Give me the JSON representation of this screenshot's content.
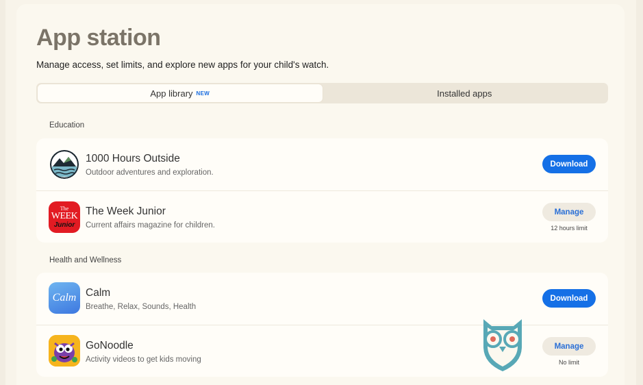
{
  "header": {
    "title": "App station",
    "subtitle": "Manage access, set limits, and explore new apps for your child's watch."
  },
  "tabs": [
    {
      "label": "App library",
      "badge": "NEW",
      "active": true
    },
    {
      "label": "Installed apps",
      "active": false
    }
  ],
  "sections": [
    {
      "label": "Education",
      "apps": [
        {
          "name": "1000 Hours Outside",
          "description": "Outdoor adventures and exploration.",
          "action": "Download",
          "icon": "mountain-lake-icon"
        },
        {
          "name": "The Week Junior",
          "description": "Current affairs magazine for children.",
          "action": "Manage",
          "limit": "12 hours limit",
          "icon": "week-junior-logo",
          "icon_text_top": "The",
          "icon_text_mid": "WEEK",
          "icon_text_bot": "Junior"
        }
      ]
    },
    {
      "label": "Health and Wellness",
      "apps": [
        {
          "name": "Calm",
          "description": "Breathe, Relax, Sounds, Health",
          "action": "Download",
          "icon": "calm-logo",
          "icon_text": "Calm"
        },
        {
          "name": "GoNoodle",
          "description": "Activity videos to get kids moving",
          "action": "Manage",
          "limit": "No limit",
          "icon": "gonoodle-character-icon"
        }
      ]
    }
  ],
  "colors": {
    "accent": "#1570e6",
    "background": "#f8f4ea",
    "week_red": "#e21b23",
    "calm_blue": "#3d8ee8",
    "owl_teal": "#58a8b6"
  }
}
